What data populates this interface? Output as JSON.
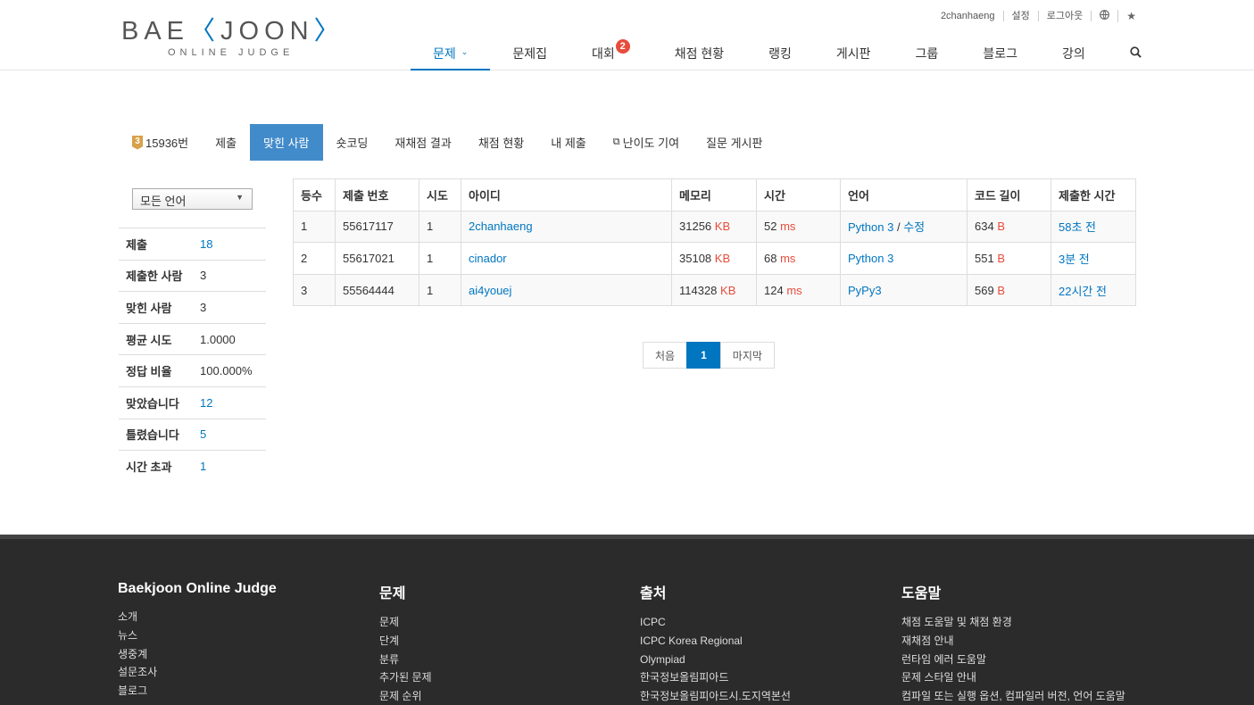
{
  "header": {
    "logo_main_a": "BAE",
    "logo_main_k": "〈",
    "logo_main_b": "JOON",
    "logo_main_c": "〉",
    "logo_sub": "ONLINE JUDGE",
    "topbar": {
      "username": "2chanhaeng",
      "settings": "설정",
      "logout": "로그아웃",
      "globe_icon": "globe-icon",
      "star_icon": "star-icon"
    },
    "nav": [
      {
        "label": "문제",
        "active": true
      },
      {
        "label": "문제집"
      },
      {
        "label": "대회",
        "badge": "2"
      },
      {
        "label": "채점 현황"
      },
      {
        "label": "랭킹"
      },
      {
        "label": "게시판"
      },
      {
        "label": "그룹"
      },
      {
        "label": "블로그"
      },
      {
        "label": "강의"
      }
    ]
  },
  "tabs": {
    "tier_badge": "3",
    "problem": "15936번",
    "submit": "제출",
    "correct_users": "맞힌 사람",
    "shortest": "숏코딩",
    "rejudge": "재채점 결과",
    "status": "채점 현황",
    "my_submit": "내 제출",
    "difficulty": "난이도 기여",
    "qna": "질문 게시판"
  },
  "sidebar": {
    "lang_select": "모든 언어",
    "stats": [
      {
        "key": "제출",
        "value": "18"
      },
      {
        "key": "제출한 사람",
        "value": "3"
      },
      {
        "key": "맞힌 사람",
        "value": "3"
      },
      {
        "key": "평균 시도",
        "value": "1.0000"
      },
      {
        "key": "정답 비율",
        "value": "100.000%"
      },
      {
        "key": "맞았습니다",
        "value": "12"
      },
      {
        "key": "틀렸습니다",
        "value": "5"
      },
      {
        "key": "시간 초과",
        "value": "1"
      }
    ]
  },
  "table": {
    "headers": [
      "등수",
      "제출 번호",
      "시도",
      "아이디",
      "메모리",
      "시간",
      "언어",
      "코드 길이",
      "제출한 시간"
    ],
    "units": {
      "memory": "KB",
      "time": "ms",
      "length": "B"
    },
    "edit_sep": "/",
    "edit_label": "수정",
    "rows": [
      {
        "rank": "1",
        "submission": "55617117",
        "tries": "1",
        "user": "2chanhaeng",
        "memory": "31256",
        "time": "52",
        "lang": "Python 3",
        "length": "634",
        "ago": "58초 전"
      },
      {
        "rank": "2",
        "submission": "55617021",
        "tries": "1",
        "user": "cinador",
        "memory": "35108",
        "time": "68",
        "lang": "Python 3",
        "length": "551",
        "ago": "3분 전"
      },
      {
        "rank": "3",
        "submission": "55564444",
        "tries": "1",
        "user": "ai4youej",
        "memory": "114328",
        "time": "124",
        "lang": "PyPy3",
        "length": "569",
        "ago": "22시간 전"
      }
    ]
  },
  "pager": {
    "first": "처음",
    "current": "1",
    "last": "마지막"
  },
  "footer": {
    "cols": [
      {
        "title": "Baekjoon Online Judge",
        "links": [
          "소개",
          "뉴스",
          "생중계",
          "설문조사",
          "블로그"
        ]
      },
      {
        "title": "문제",
        "links": [
          "문제",
          "단계",
          "분류",
          "추가된 문제",
          "문제 순위"
        ]
      },
      {
        "title": "출처",
        "links": [
          "ICPC",
          "ICPC Korea Regional",
          "Olympiad",
          "한국정보올림피아드",
          "한국정보올림피아드시.도지역본선"
        ]
      },
      {
        "title": "도움말",
        "links": [
          "채점 도움말 및 채점 환경",
          "재채점 안내",
          "런타임 에러 도움말",
          "문제 스타일 안내",
          "컴파일 또는 실행 옵션, 컴파일러 버전, 언어 도움말"
        ]
      }
    ]
  }
}
